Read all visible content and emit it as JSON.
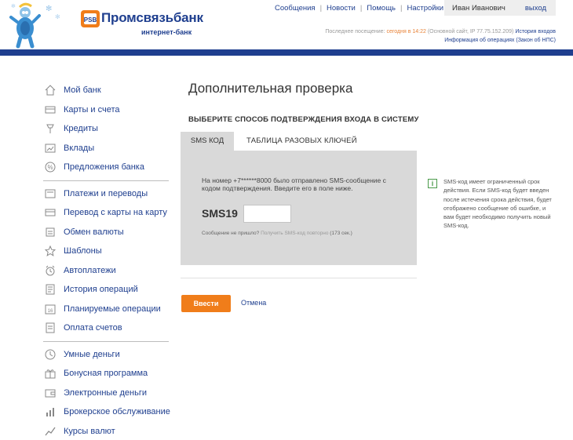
{
  "header": {
    "bank_name": "Промсвязьбанк",
    "bank_sub": "интернет-банк",
    "nav": [
      {
        "label": "Сообщения"
      },
      {
        "label": "Новости"
      },
      {
        "label": "Помощь"
      },
      {
        "label": "Настройки"
      }
    ],
    "user_name": "Иван Иванович",
    "logout": "выход",
    "last_visit_label": "Последнее посещение:",
    "last_visit_time": "сегодня в 14:22",
    "last_visit_site": "(Основной сайт, IP 77.75.152.209)",
    "history_link": "История входов",
    "ops_info": "Информация об операциях (Закон об НПС)"
  },
  "sidebar": {
    "groups": [
      [
        {
          "label": "Мой банк",
          "icon": "home-icon"
        },
        {
          "label": "Карты и счета",
          "icon": "card-icon"
        },
        {
          "label": "Кредиты",
          "icon": "credit-icon"
        },
        {
          "label": "Вклады",
          "icon": "deposit-icon"
        },
        {
          "label": "Предложения банка",
          "icon": "percent-icon"
        }
      ],
      [
        {
          "label": "Платежи и переводы",
          "icon": "payment-icon"
        },
        {
          "label": "Перевод с карты на карту",
          "icon": "card-transfer-icon"
        },
        {
          "label": "Обмен валюты",
          "icon": "exchange-icon"
        },
        {
          "label": "Шаблоны",
          "icon": "star-icon"
        },
        {
          "label": "Автоплатежи",
          "icon": "alarm-icon"
        },
        {
          "label": "История операций",
          "icon": "history-icon"
        },
        {
          "label": "Планируемые операции",
          "icon": "calendar-icon"
        },
        {
          "label": "Оплата счетов",
          "icon": "invoice-icon"
        }
      ],
      [
        {
          "label": "Умные деньги",
          "icon": "clock-icon"
        },
        {
          "label": "Бонусная программа",
          "icon": "gift-icon"
        },
        {
          "label": "Электронные деньги",
          "icon": "wallet-icon"
        },
        {
          "label": "Брокерское обслуживание",
          "icon": "bars-icon"
        },
        {
          "label": "Курсы валют",
          "icon": "trend-icon"
        }
      ]
    ]
  },
  "main": {
    "title": "Дополнительная проверка",
    "subtitle": "ВЫБЕРИТЕ СПОСОБ ПОДТВЕРЖДЕНИЯ ВХОДА В СИСТЕМУ",
    "tabs": [
      {
        "label": "SMS КОД",
        "active": true
      },
      {
        "label": "ТАБЛИЦА РАЗОВЫХ КЛЮЧЕЙ",
        "active": false
      }
    ],
    "panel_text": "На номер +7******8000 было отправлено SMS-сообщение с кодом подтверждения. Введите его в поле ниже.",
    "sms_label": "SMS19",
    "sms_value": "",
    "resend_text": "Сообщение не пришло?",
    "resend_link": "Получить SMS-код повторно",
    "resend_timer": "(173 сек.)",
    "submit_label": "Ввести",
    "cancel_label": "Отмена"
  },
  "info": {
    "icon": "info-icon",
    "text": "SMS-код имеет ограниченный срок действия. Если SMS-код будет введен после истечения срока действия, будет отображено сообщение об ошибке, и вам будет необходимо получить новый SMS-код."
  },
  "colors": {
    "brand": "#1f3f8f",
    "accent": "#f07d1a",
    "panel": "#d9d9d9"
  }
}
